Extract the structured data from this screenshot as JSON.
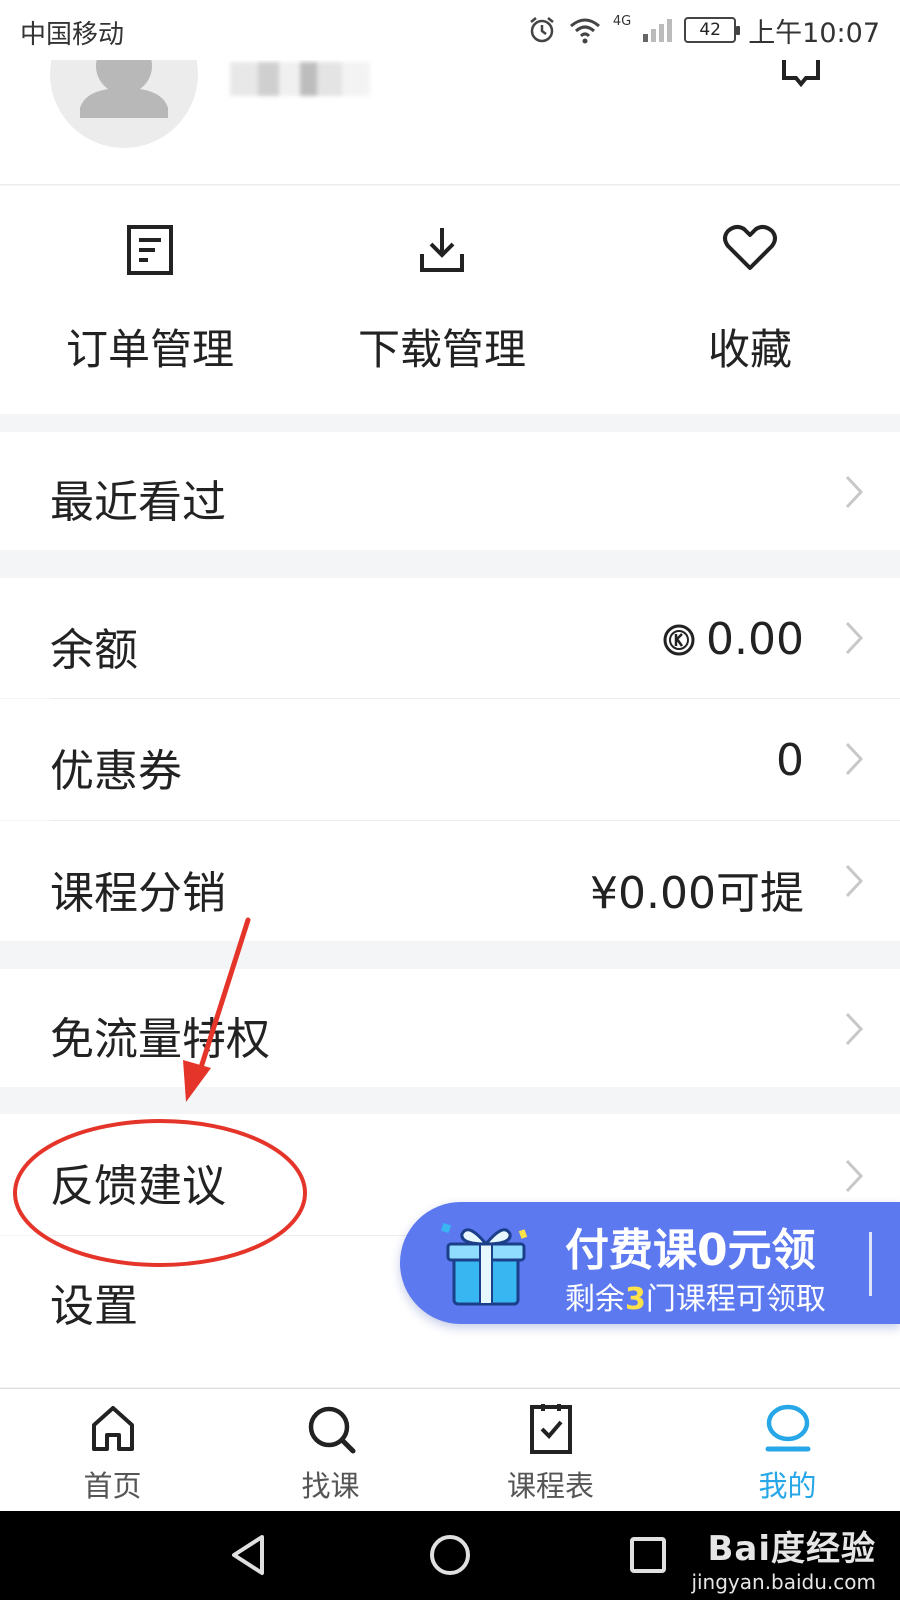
{
  "status_bar": {
    "carrier": "中国移动",
    "network": "4G",
    "battery": "42",
    "time": "上午10:07"
  },
  "quick_actions": [
    {
      "label": "订单管理",
      "icon": "order-doc-icon"
    },
    {
      "label": "下载管理",
      "icon": "download-icon"
    },
    {
      "label": "收藏",
      "icon": "heart-icon"
    }
  ],
  "menu": {
    "recent": "最近看过",
    "balance": {
      "label": "余额",
      "value": "0.00",
      "icon": "k-coin-icon"
    },
    "coupon": {
      "label": "优惠券",
      "value": "0"
    },
    "distribution": {
      "label": "课程分销",
      "value": "¥0.00可提"
    },
    "free_data": "免流量特权",
    "feedback": "反馈建议",
    "settings": "设置"
  },
  "promo": {
    "title": "付费课0元领",
    "sub_prefix": "剩余",
    "sub_count": "3",
    "sub_suffix": "门课程可领取"
  },
  "tabs": [
    {
      "label": "首页",
      "icon": "home-icon"
    },
    {
      "label": "找课",
      "icon": "search-icon"
    },
    {
      "label": "课程表",
      "icon": "schedule-check-icon"
    },
    {
      "label": "我的",
      "icon": "profile-icon"
    }
  ],
  "watermark": {
    "brand": "Bai度经验",
    "url": "jingyan.baidu.com"
  },
  "colors": {
    "accent": "#27a7e8",
    "promo_bg": "#5c79f0",
    "annotation": "#e5352a",
    "highlight": "#ffe14a"
  }
}
